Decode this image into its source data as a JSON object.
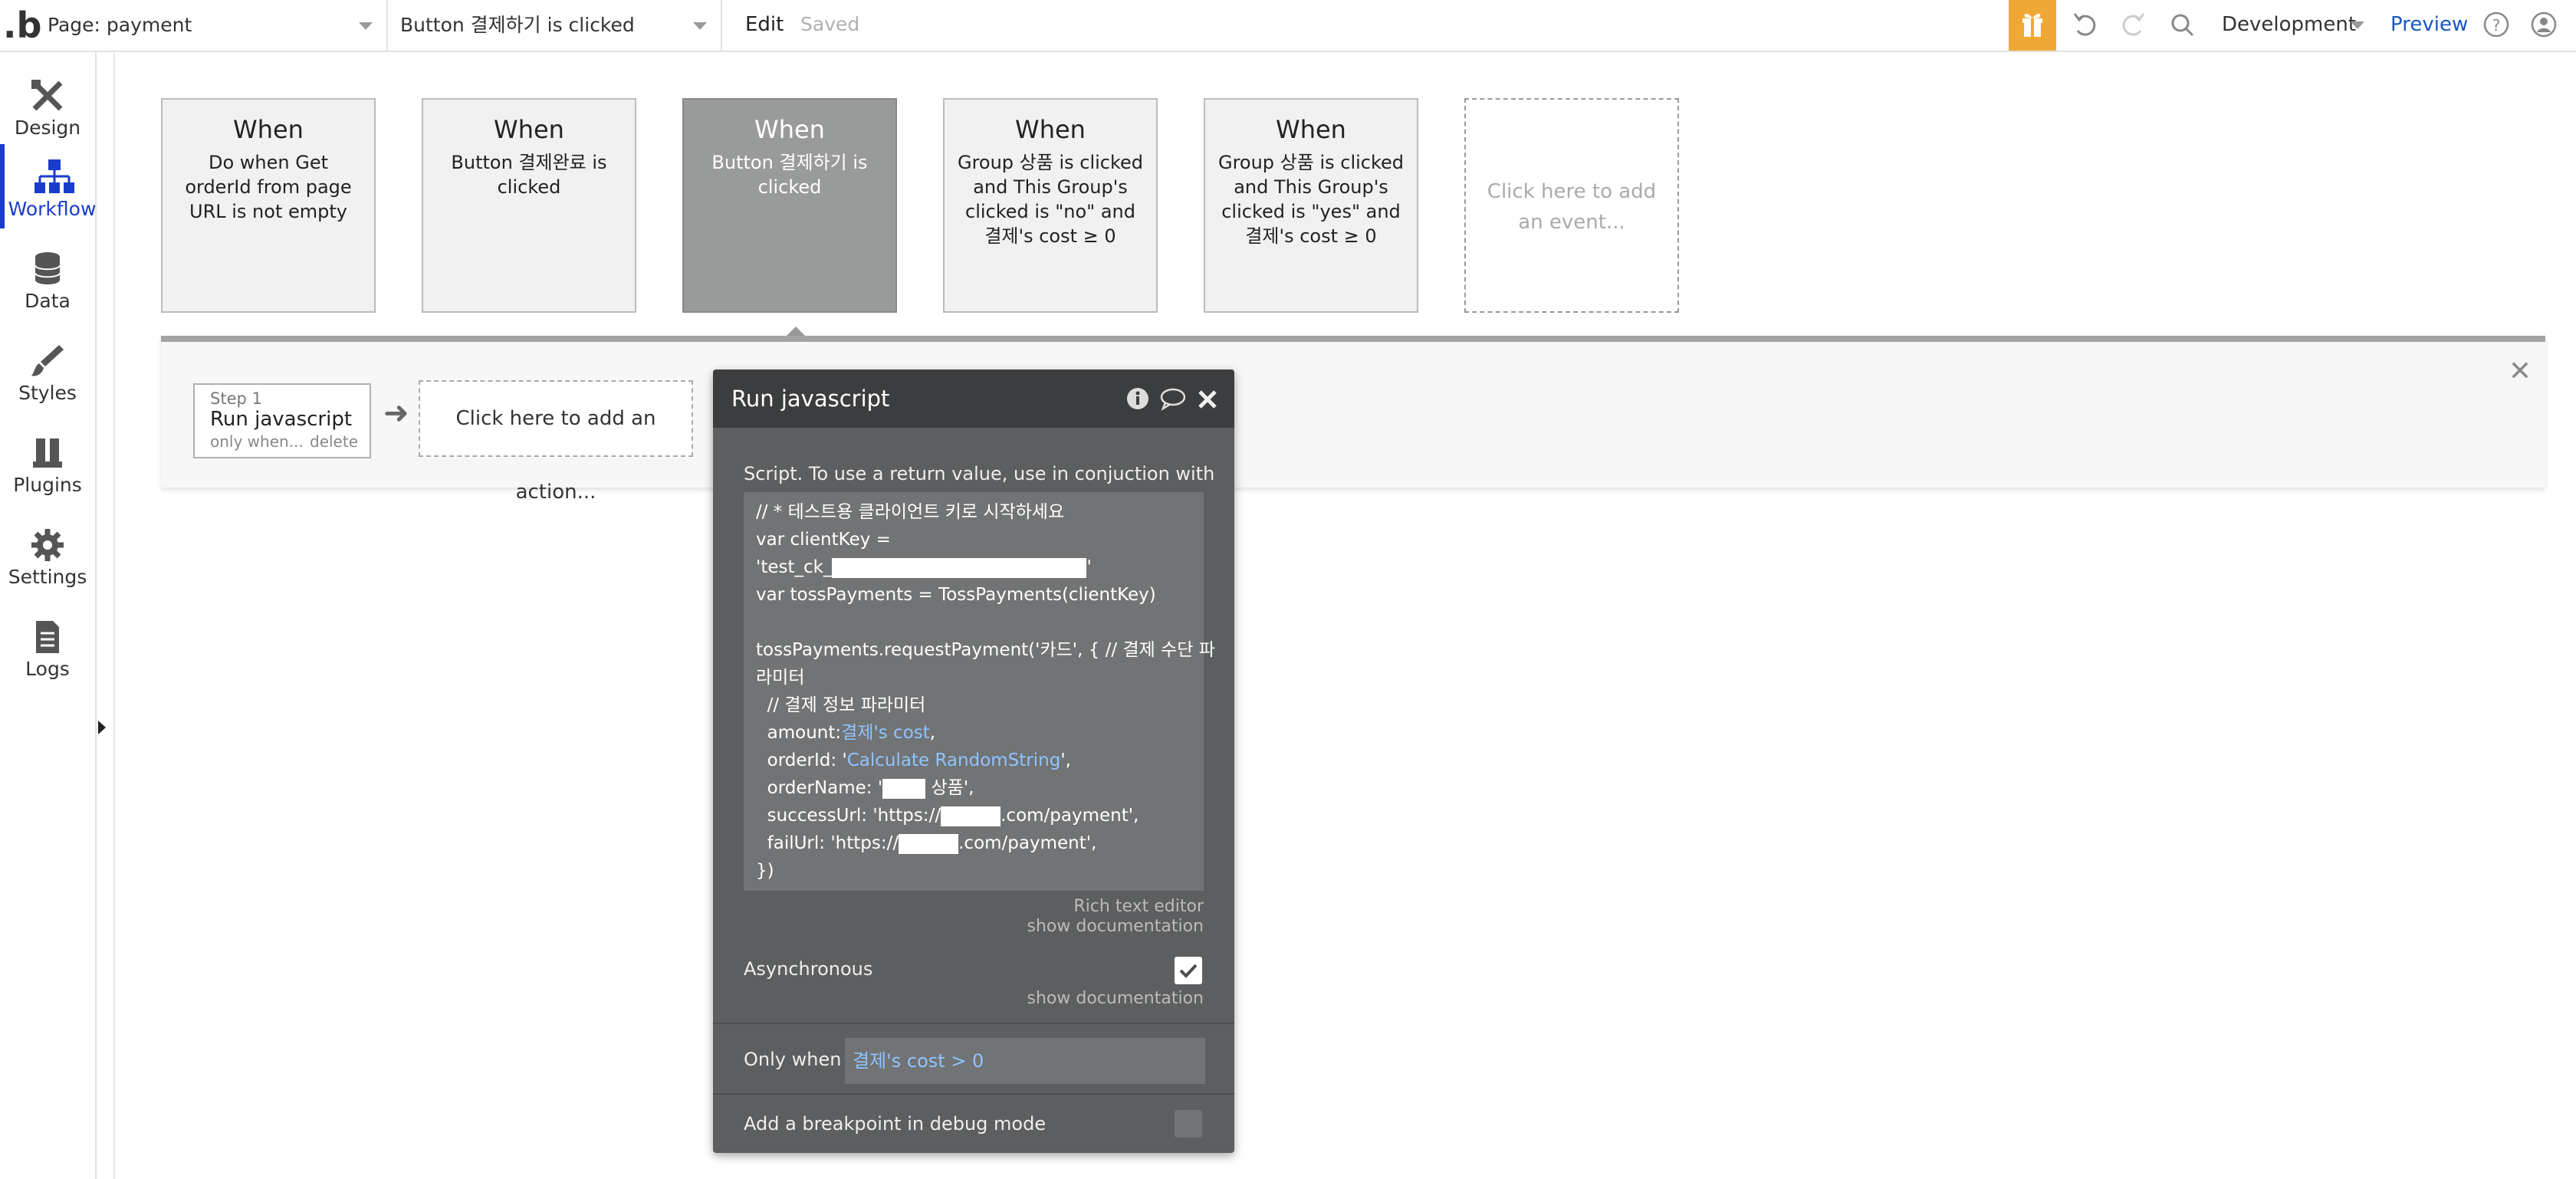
{
  "topbar": {
    "logo": ".b",
    "page_select": "Page: payment",
    "event_select": "Button 결제하기 is clicked",
    "edit": "Edit",
    "saved": "Saved",
    "env": "Development",
    "preview": "Preview"
  },
  "sidebar": {
    "items": [
      {
        "label": "Design"
      },
      {
        "label": "Workflow"
      },
      {
        "label": "Data"
      },
      {
        "label": "Styles"
      },
      {
        "label": "Plugins"
      },
      {
        "label": "Settings"
      },
      {
        "label": "Logs"
      }
    ]
  },
  "events": [
    {
      "when": "When",
      "desc": "Do when Get orderId from page URL is not empty"
    },
    {
      "when": "When",
      "desc": "Button 결제완료 is clicked"
    },
    {
      "when": "When",
      "desc": "Button 결제하기 is clicked"
    },
    {
      "when": "When",
      "desc": "Group 상품 is clicked and This Group's clicked is \"no\" and 결제's cost ≥ 0"
    },
    {
      "when": "When",
      "desc": "Group 상품 is clicked and This Group's clicked is \"yes\" and 결제's cost ≥ 0"
    },
    {
      "when": "",
      "desc": "Click here to add an event..."
    }
  ],
  "step": {
    "num": "Step 1",
    "name": "Run javascript",
    "only_when": "only when...",
    "delete": "delete"
  },
  "add_action": "Click here to add an action...",
  "panel": {
    "title": "Run javascript",
    "script_label": "Script. To use a return value, use in conjuction with",
    "code": {
      "l1": "// * 테스트용 클라이언트 키로 시작하세요",
      "l2": "var clientKey =",
      "l3a": "'test_ck_",
      "l3b": "'",
      "l4": "var tossPayments = TossPayments(clientKey)",
      "l5": "tossPayments.requestPayment('카드', { // 결제 수단 파",
      "l6": "라미터",
      "l7": "  // 결제 정보 파라미터",
      "l8a": "  amount:",
      "l8b": "결제's cost",
      "l8c": ",",
      "l9a": "  orderId: '",
      "l9b": "Calculate RandomString",
      "l9c": "',",
      "l10a": "  orderName: '",
      "l10b": " 상품',",
      "l11a": "  successUrl: 'https://",
      "l11b": ".com/payment',",
      "l12a": "  failUrl: 'https://",
      "l12b": ".com/payment',",
      "l13": "})"
    },
    "rich_text": "Rich text editor",
    "show_doc": "show documentation",
    "async_label": "Asynchronous",
    "async_checked": true,
    "async_doc": "show documentation",
    "only_when_label": "Only when",
    "only_when_value": "결제's cost > 0",
    "breakpoint_label": "Add a breakpoint in debug mode",
    "breakpoint_checked": false
  }
}
